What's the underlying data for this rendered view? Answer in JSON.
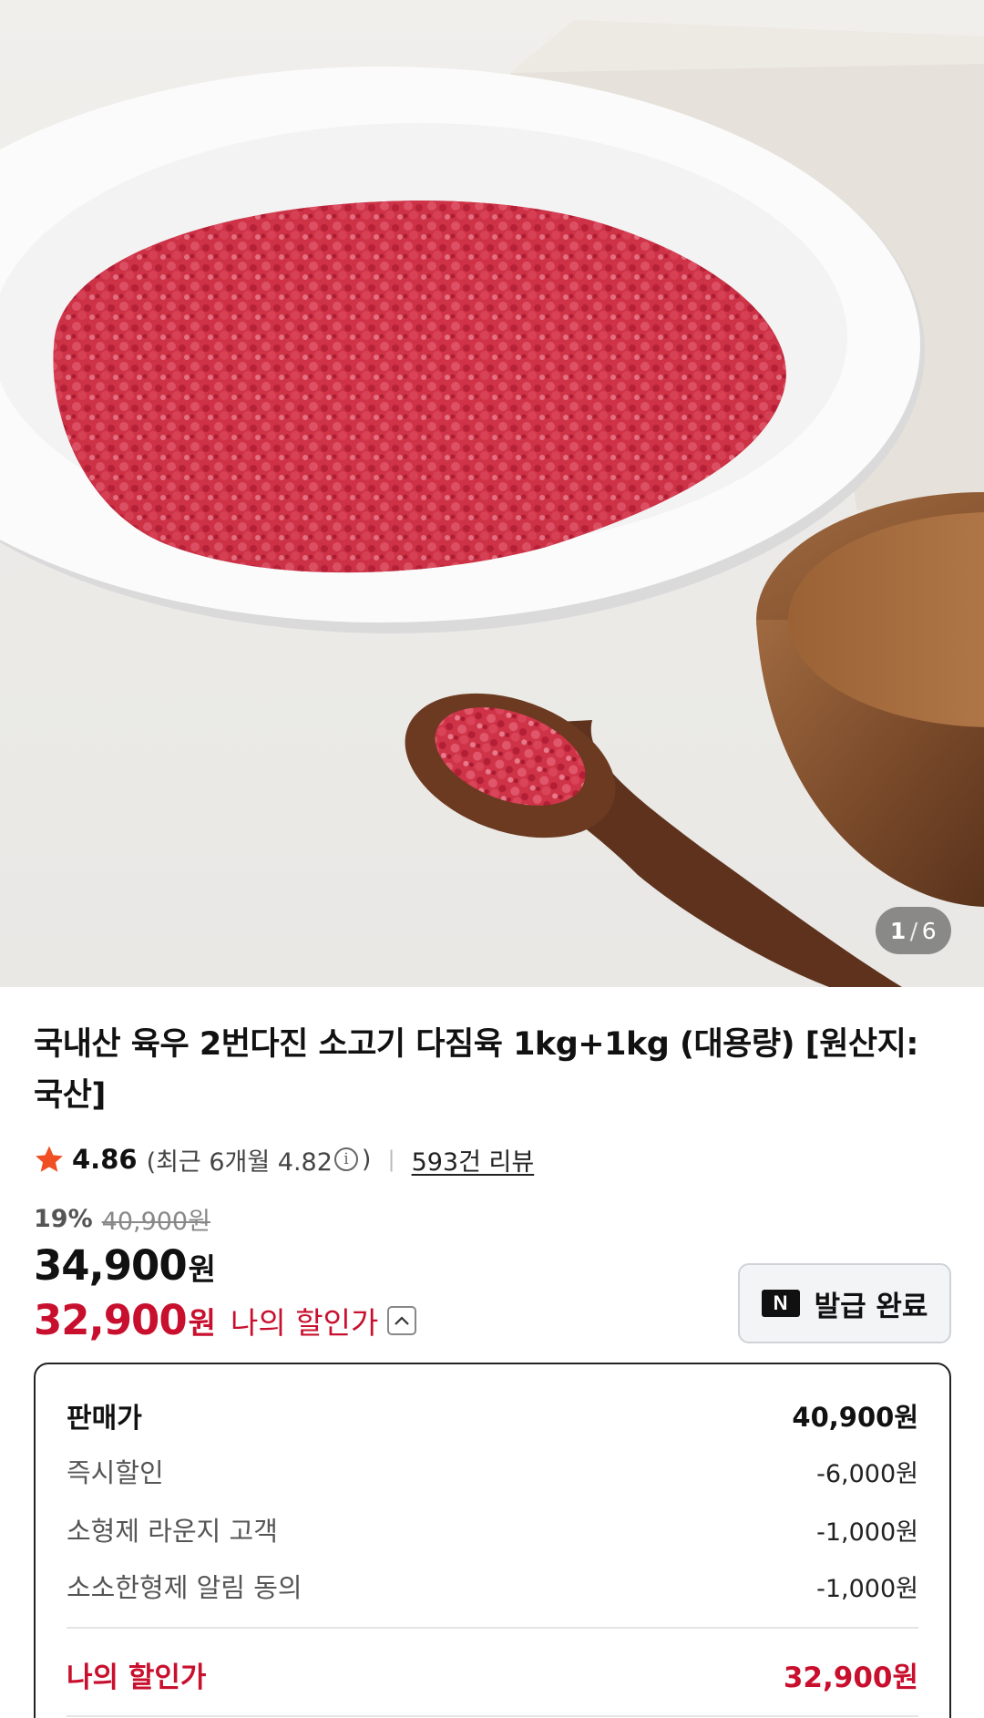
{
  "gallery": {
    "current": "1",
    "separator": "/",
    "total": "6"
  },
  "product": {
    "title": "국내산 육우 2번다진 소고기 다짐육 1kg+1kg (대용량) [원산지: 국산]"
  },
  "rating": {
    "score": "4.86",
    "recent_open": "(최근 6개월 4.82",
    "info_glyph": "i",
    "recent_close": ")",
    "divider": "|",
    "reviews": "593건 리뷰"
  },
  "price": {
    "discount_rate": "19%",
    "original": "40,900원",
    "sale_value": "34,900",
    "sale_unit": "원",
    "my_value": "32,900",
    "my_unit": "원",
    "my_label": "나의 할인가"
  },
  "coupon": {
    "logo": "N",
    "label": "발급 완료"
  },
  "breakdown": {
    "rows": [
      {
        "label": "판매가",
        "value": "40,900원"
      },
      {
        "label": "즉시할인",
        "value": "-6,000원"
      },
      {
        "label": "소형제 라운지 고객",
        "value": "-1,000원"
      },
      {
        "label": "소소한형제 알림 동의",
        "value": "-1,000원"
      }
    ],
    "total": {
      "label": "나의 할인가",
      "value": "32,900원"
    }
  },
  "colors": {
    "accent_red": "#c8102e",
    "star": "#f04e23"
  }
}
